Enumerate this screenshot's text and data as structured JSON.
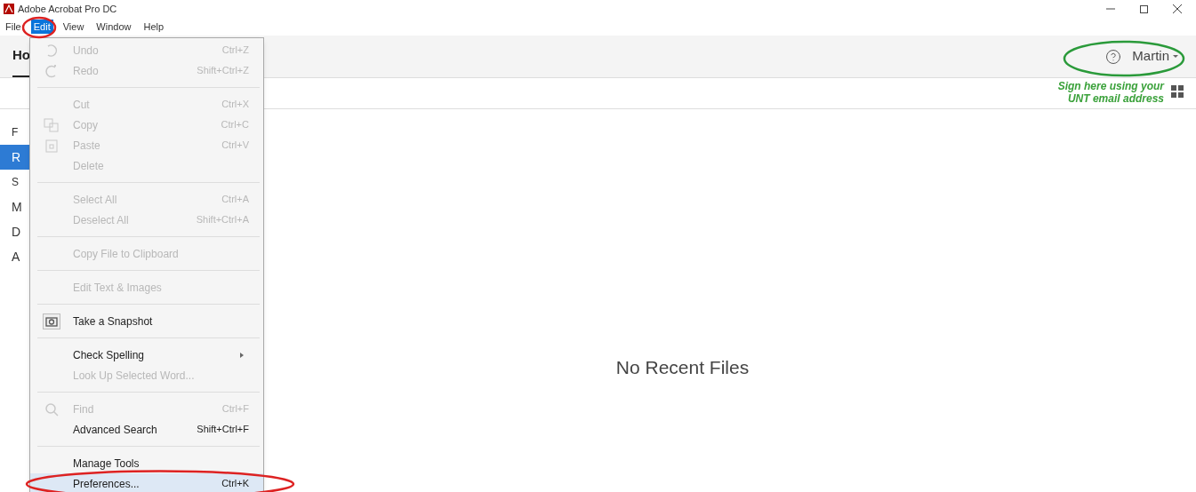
{
  "window": {
    "title": "Adobe Acrobat Pro DC"
  },
  "menu_bar": [
    {
      "label": "File",
      "selected": false
    },
    {
      "label": "Edit",
      "selected": true
    },
    {
      "label": "View",
      "selected": false
    },
    {
      "label": "Window",
      "selected": false
    },
    {
      "label": "Help",
      "selected": false
    }
  ],
  "tabs": [
    {
      "label": "Ho",
      "selected": true
    }
  ],
  "account": {
    "name": "Martin"
  },
  "note": "Sign here using your UNT email address",
  "sidebar": [
    {
      "label": "F",
      "kind": "heading",
      "selected": false
    },
    {
      "label": "R",
      "kind": "item",
      "selected": true
    },
    {
      "label": "S",
      "kind": "heading",
      "selected": false
    },
    {
      "label": "M",
      "kind": "item",
      "selected": false
    },
    {
      "label": "D",
      "kind": "item",
      "selected": false
    },
    {
      "label": "A",
      "kind": "item",
      "selected": false
    }
  ],
  "edit_menu": [
    {
      "kind": "item",
      "label": "Undo",
      "shortcut": "Ctrl+Z",
      "disabled": true,
      "selected": false
    },
    {
      "kind": "item",
      "label": "Redo",
      "shortcut": "Shift+Ctrl+Z",
      "disabled": true,
      "selected": false
    },
    {
      "kind": "separator"
    },
    {
      "kind": "item",
      "label": "Cut",
      "shortcut": "Ctrl+X",
      "disabled": true,
      "selected": false
    },
    {
      "kind": "item",
      "label": "Copy",
      "shortcut": "Ctrl+C",
      "disabled": true,
      "selected": false
    },
    {
      "kind": "item",
      "label": "Paste",
      "shortcut": "Ctrl+V",
      "disabled": true,
      "selected": false
    },
    {
      "kind": "item",
      "label": "Delete",
      "disabled": true,
      "selected": false
    },
    {
      "kind": "separator"
    },
    {
      "kind": "item",
      "label": "Select All",
      "shortcut": "Ctrl+A",
      "disabled": true,
      "selected": false
    },
    {
      "kind": "item",
      "label": "Deselect All",
      "shortcut": "Shift+Ctrl+A",
      "disabled": true,
      "selected": false
    },
    {
      "kind": "separator"
    },
    {
      "kind": "item",
      "label": "Copy File to Clipboard",
      "disabled": true,
      "selected": false
    },
    {
      "kind": "separator"
    },
    {
      "kind": "item",
      "label": "Edit Text & Images",
      "disabled": true,
      "selected": false
    },
    {
      "kind": "separator"
    },
    {
      "kind": "item",
      "label": "Take a Snapshot",
      "disabled": false,
      "selected": false
    },
    {
      "kind": "separator"
    },
    {
      "kind": "item",
      "label": "Check Spelling",
      "submenu": true,
      "disabled": false,
      "selected": false
    },
    {
      "kind": "item",
      "label": "Look Up Selected Word...",
      "disabled": true,
      "selected": false
    },
    {
      "kind": "separator"
    },
    {
      "kind": "item",
      "label": "Find",
      "shortcut": "Ctrl+F",
      "disabled": true,
      "selected": false
    },
    {
      "kind": "item",
      "label": "Advanced Search",
      "shortcut": "Shift+Ctrl+F",
      "disabled": false,
      "selected": false
    },
    {
      "kind": "separator"
    },
    {
      "kind": "item",
      "label": "Manage Tools",
      "disabled": false,
      "selected": false
    },
    {
      "kind": "item",
      "label": "Preferences...",
      "shortcut": "Ctrl+K",
      "disabled": false,
      "selected": true
    }
  ],
  "empty_state": "No Recent Files"
}
